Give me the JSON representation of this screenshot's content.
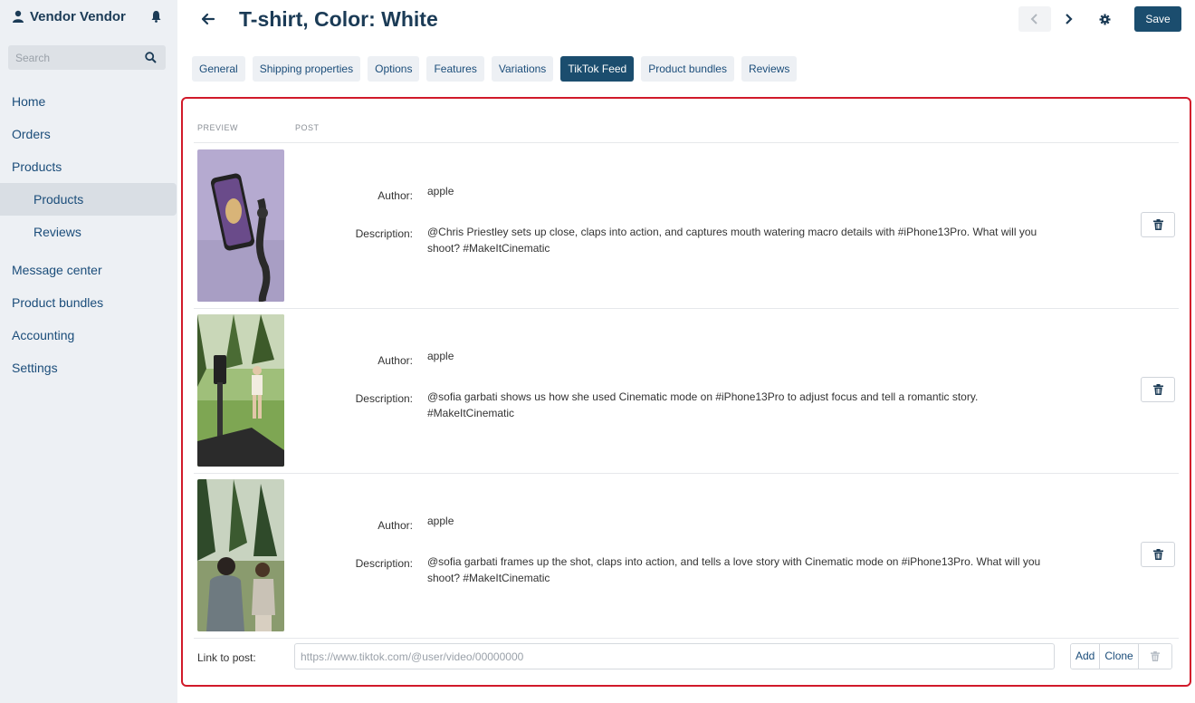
{
  "sidebar": {
    "brand": "Vendor Vendor",
    "search_placeholder": "Search",
    "items": [
      {
        "label": "Home"
      },
      {
        "label": "Orders"
      },
      {
        "label": "Products"
      },
      {
        "label": "Products"
      },
      {
        "label": "Reviews"
      },
      {
        "label": "Message center"
      },
      {
        "label": "Product bundles"
      },
      {
        "label": "Accounting"
      },
      {
        "label": "Settings"
      }
    ]
  },
  "header": {
    "title": "T-shirt, Color: White",
    "save_label": "Save"
  },
  "tabs": [
    {
      "label": "General"
    },
    {
      "label": "Shipping properties"
    },
    {
      "label": "Options"
    },
    {
      "label": "Features"
    },
    {
      "label": "Variations"
    },
    {
      "label": "TikTok Feed",
      "active": true
    },
    {
      "label": "Product bundles"
    },
    {
      "label": "Reviews"
    }
  ],
  "feed": {
    "col_preview": "PREVIEW",
    "col_post": "POST",
    "author_label": "Author:",
    "description_label": "Description:",
    "posts": [
      {
        "author": "apple",
        "description": "@Chris Priestley sets up close, claps into action, and captures mouth watering macro details with #iPhone13Pro. What will you shoot? #MakeItCinematic"
      },
      {
        "author": "apple",
        "description": "@sofia garbati shows us how she used Cinematic mode on #iPhone13Pro to adjust focus and tell a romantic story. #MakeItCinematic"
      },
      {
        "author": "apple",
        "description": "@sofia garbati frames up the shot, claps into action, and tells a love story with Cinematic mode on #iPhone13Pro. What will you shoot? #MakeItCinematic"
      }
    ],
    "link_label": "Link to post:",
    "link_placeholder": "https://www.tiktok.com/@user/video/00000000",
    "add_label": "Add",
    "clone_label": "Clone"
  },
  "colors": {
    "accent": "#1b4d6e",
    "sidebar_bg": "#edf0f4",
    "highlight_border": "#d11a2a"
  }
}
